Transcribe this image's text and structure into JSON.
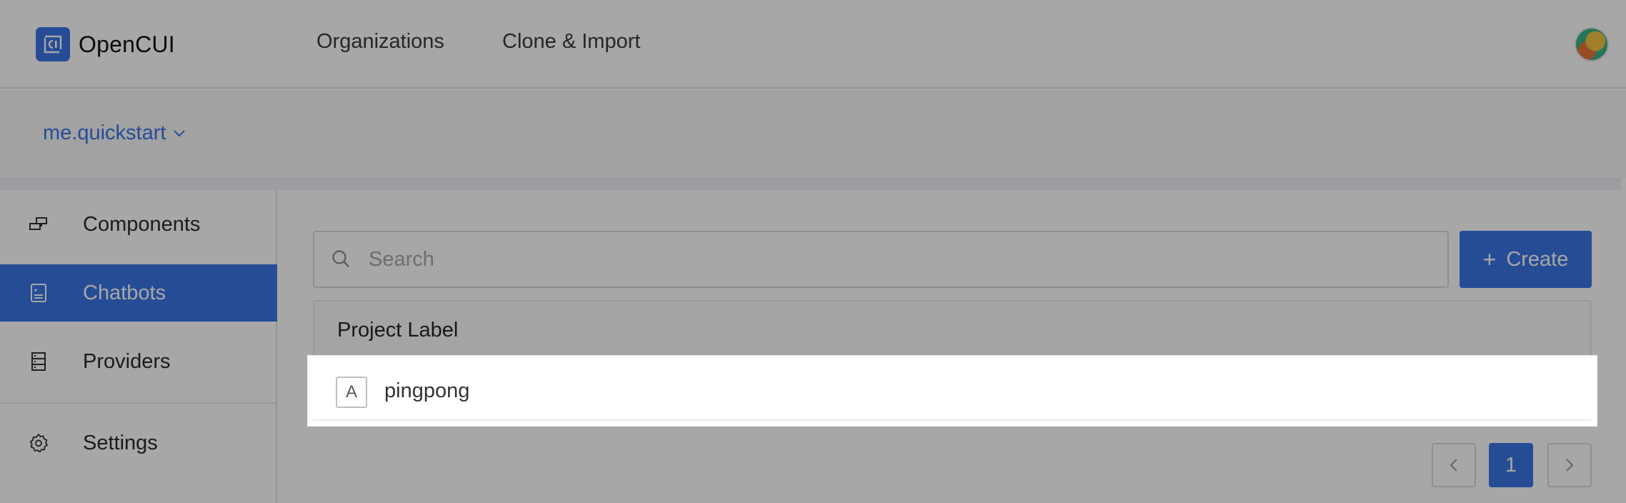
{
  "app": {
    "name": "OpenCUI",
    "logo_icon": "opencui-logo-icon",
    "accent_color": "#3a75e6"
  },
  "topnav": {
    "items": [
      {
        "label": "Organizations"
      },
      {
        "label": "Clone & Import"
      }
    ],
    "avatar_icon": "user-avatar"
  },
  "org": {
    "current": "me.quickstart",
    "dropdown_icon": "chevron-down-icon"
  },
  "sidebar": {
    "items": [
      {
        "label": "Components",
        "icon": "components-icon",
        "active": false
      },
      {
        "label": "Chatbots",
        "icon": "chatbot-icon",
        "active": true
      },
      {
        "label": "Providers",
        "icon": "providers-icon",
        "active": false
      },
      {
        "label": "Settings",
        "icon": "gear-icon",
        "active": false
      }
    ]
  },
  "search": {
    "placeholder": "Search",
    "value": "",
    "icon": "search-icon"
  },
  "create_button": {
    "label": "Create",
    "icon": "plus-icon"
  },
  "table": {
    "header": "Project Label",
    "rows": [
      {
        "badge": "A",
        "label": "pingpong"
      }
    ]
  },
  "pagination": {
    "current_page": "1",
    "prev_icon": "chevron-left-icon",
    "next_icon": "chevron-right-icon"
  }
}
